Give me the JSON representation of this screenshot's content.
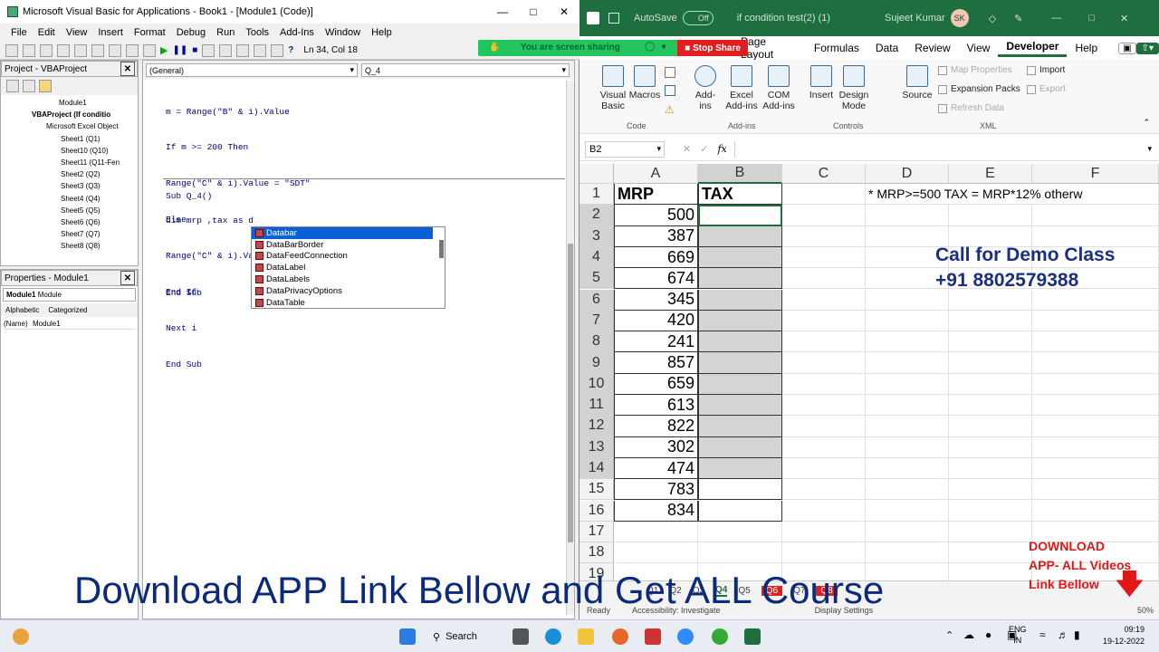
{
  "vba": {
    "title": "Microsoft Visual Basic for Applications - Book1 - [Module1 (Code)]",
    "menu": [
      "File",
      "Edit",
      "View",
      "Insert",
      "Format",
      "Debug",
      "Run",
      "Tools",
      "Add-Ins",
      "Window",
      "Help"
    ],
    "cursor_pos": "Ln 34, Col 18",
    "project_title": "Project - VBAProject",
    "tree": [
      "Module1",
      "VBAProject (If conditio",
      "Microsoft Excel Object",
      "Sheet1 (Q1)",
      "Sheet10 (Q10)",
      "Sheet11 (Q11-Fen",
      "Sheet2 (Q2)",
      "Sheet3 (Q3)",
      "Sheet4 (Q4)",
      "Sheet5 (Q5)",
      "Sheet6 (Q6)",
      "Sheet7 (Q7)",
      "Sheet8 (Q8)"
    ],
    "properties_title": "Properties - Module1",
    "properties_object": "Module1",
    "properties_type": "Module",
    "prop_tabs": [
      "Alphabetic",
      "Categorized"
    ],
    "prop_name_key": "(Name)",
    "prop_name_val": "Module1",
    "combo_general": "(General)",
    "combo_proc": "Q_4",
    "code_lines": [
      "m = Range(\"B\" & i).Value",
      "If m >= 200 Then",
      "Range(\"C\" & i).Value = \"SDT\"",
      "Else",
      "Range(\"C\" & i).Value = \"Local\"",
      "End If",
      "Next i",
      "End Sub"
    ],
    "sub_line": "Sub Q_4()",
    "dim_line": "dim mrp ,tax as d",
    "end_sub": "End Sub",
    "autocomplete": [
      "Databar",
      "DataBarBorder",
      "DataFeedConnection",
      "DataLabel",
      "DataLabels",
      "DataPrivacyOptions",
      "DataTable"
    ]
  },
  "share": {
    "text": "You are screen sharing",
    "stop": "Stop Share"
  },
  "excel": {
    "autosave": "AutoSave",
    "autosave_state": "Off",
    "file": "if condition test(2) (1)",
    "user": "Sujeet Kumar",
    "user_initials": "SK",
    "tabs": [
      "Page Layout",
      "Formulas",
      "Data",
      "Review",
      "View",
      "Developer",
      "Help"
    ],
    "active_tab": "Developer",
    "ribbon": {
      "visual_basic": "Visual\nBasic",
      "macros": "Macros",
      "code_group": "Code",
      "add_ins": "Add-\nins",
      "excel_addins": "Excel\nAdd-ins",
      "com_addins": "COM\nAdd-ins",
      "addins_group": "Add-ins",
      "insert": "Insert",
      "design_mode": "Design\nMode",
      "controls_group": "Controls",
      "source": "Source",
      "map_properties": "Map Properties",
      "expansion_packs": "Expansion Packs",
      "refresh_data": "Refresh Data",
      "import": "Import",
      "export": "Export",
      "xml_group": "XML"
    },
    "namebox": "B2",
    "fx": "fx",
    "columns": [
      "A",
      "B",
      "C",
      "D",
      "E",
      "F"
    ],
    "header_a": "MRP",
    "header_b": "TAX",
    "note": "* MRP>=500 TAX = MRP*12% otherwis",
    "rows": [
      1,
      2,
      3,
      4,
      5,
      6,
      7,
      8,
      9,
      10,
      11,
      12,
      13,
      14,
      15,
      16,
      17,
      18,
      19
    ],
    "mrp": [
      500,
      387,
      669,
      674,
      345,
      420,
      241,
      857,
      659,
      613,
      822,
      302,
      474,
      783,
      834
    ],
    "sheet_tabs": [
      "Q1",
      "Q2",
      "Q3",
      "Q4",
      "Q5",
      "Q6",
      "Q7",
      "Q8"
    ],
    "status_ready": "Ready",
    "status_access": "Accessibility: Investigate",
    "status_display": "Display Settings",
    "zoom": "50%"
  },
  "overlay": {
    "banner": "Download APP Link Bellow and Get ALL Course",
    "demo_line1": "Call for Demo Class",
    "demo_line2": "+91 8802579388",
    "dl_line1": "DOWNLOAD",
    "dl_line2": "APP- ALL Videos",
    "dl_line3": "Link Bellow"
  },
  "taskbar": {
    "search": "Search",
    "lang1": "ENG",
    "lang2": "IN",
    "time": "09:19",
    "date": "19-12-2022"
  }
}
